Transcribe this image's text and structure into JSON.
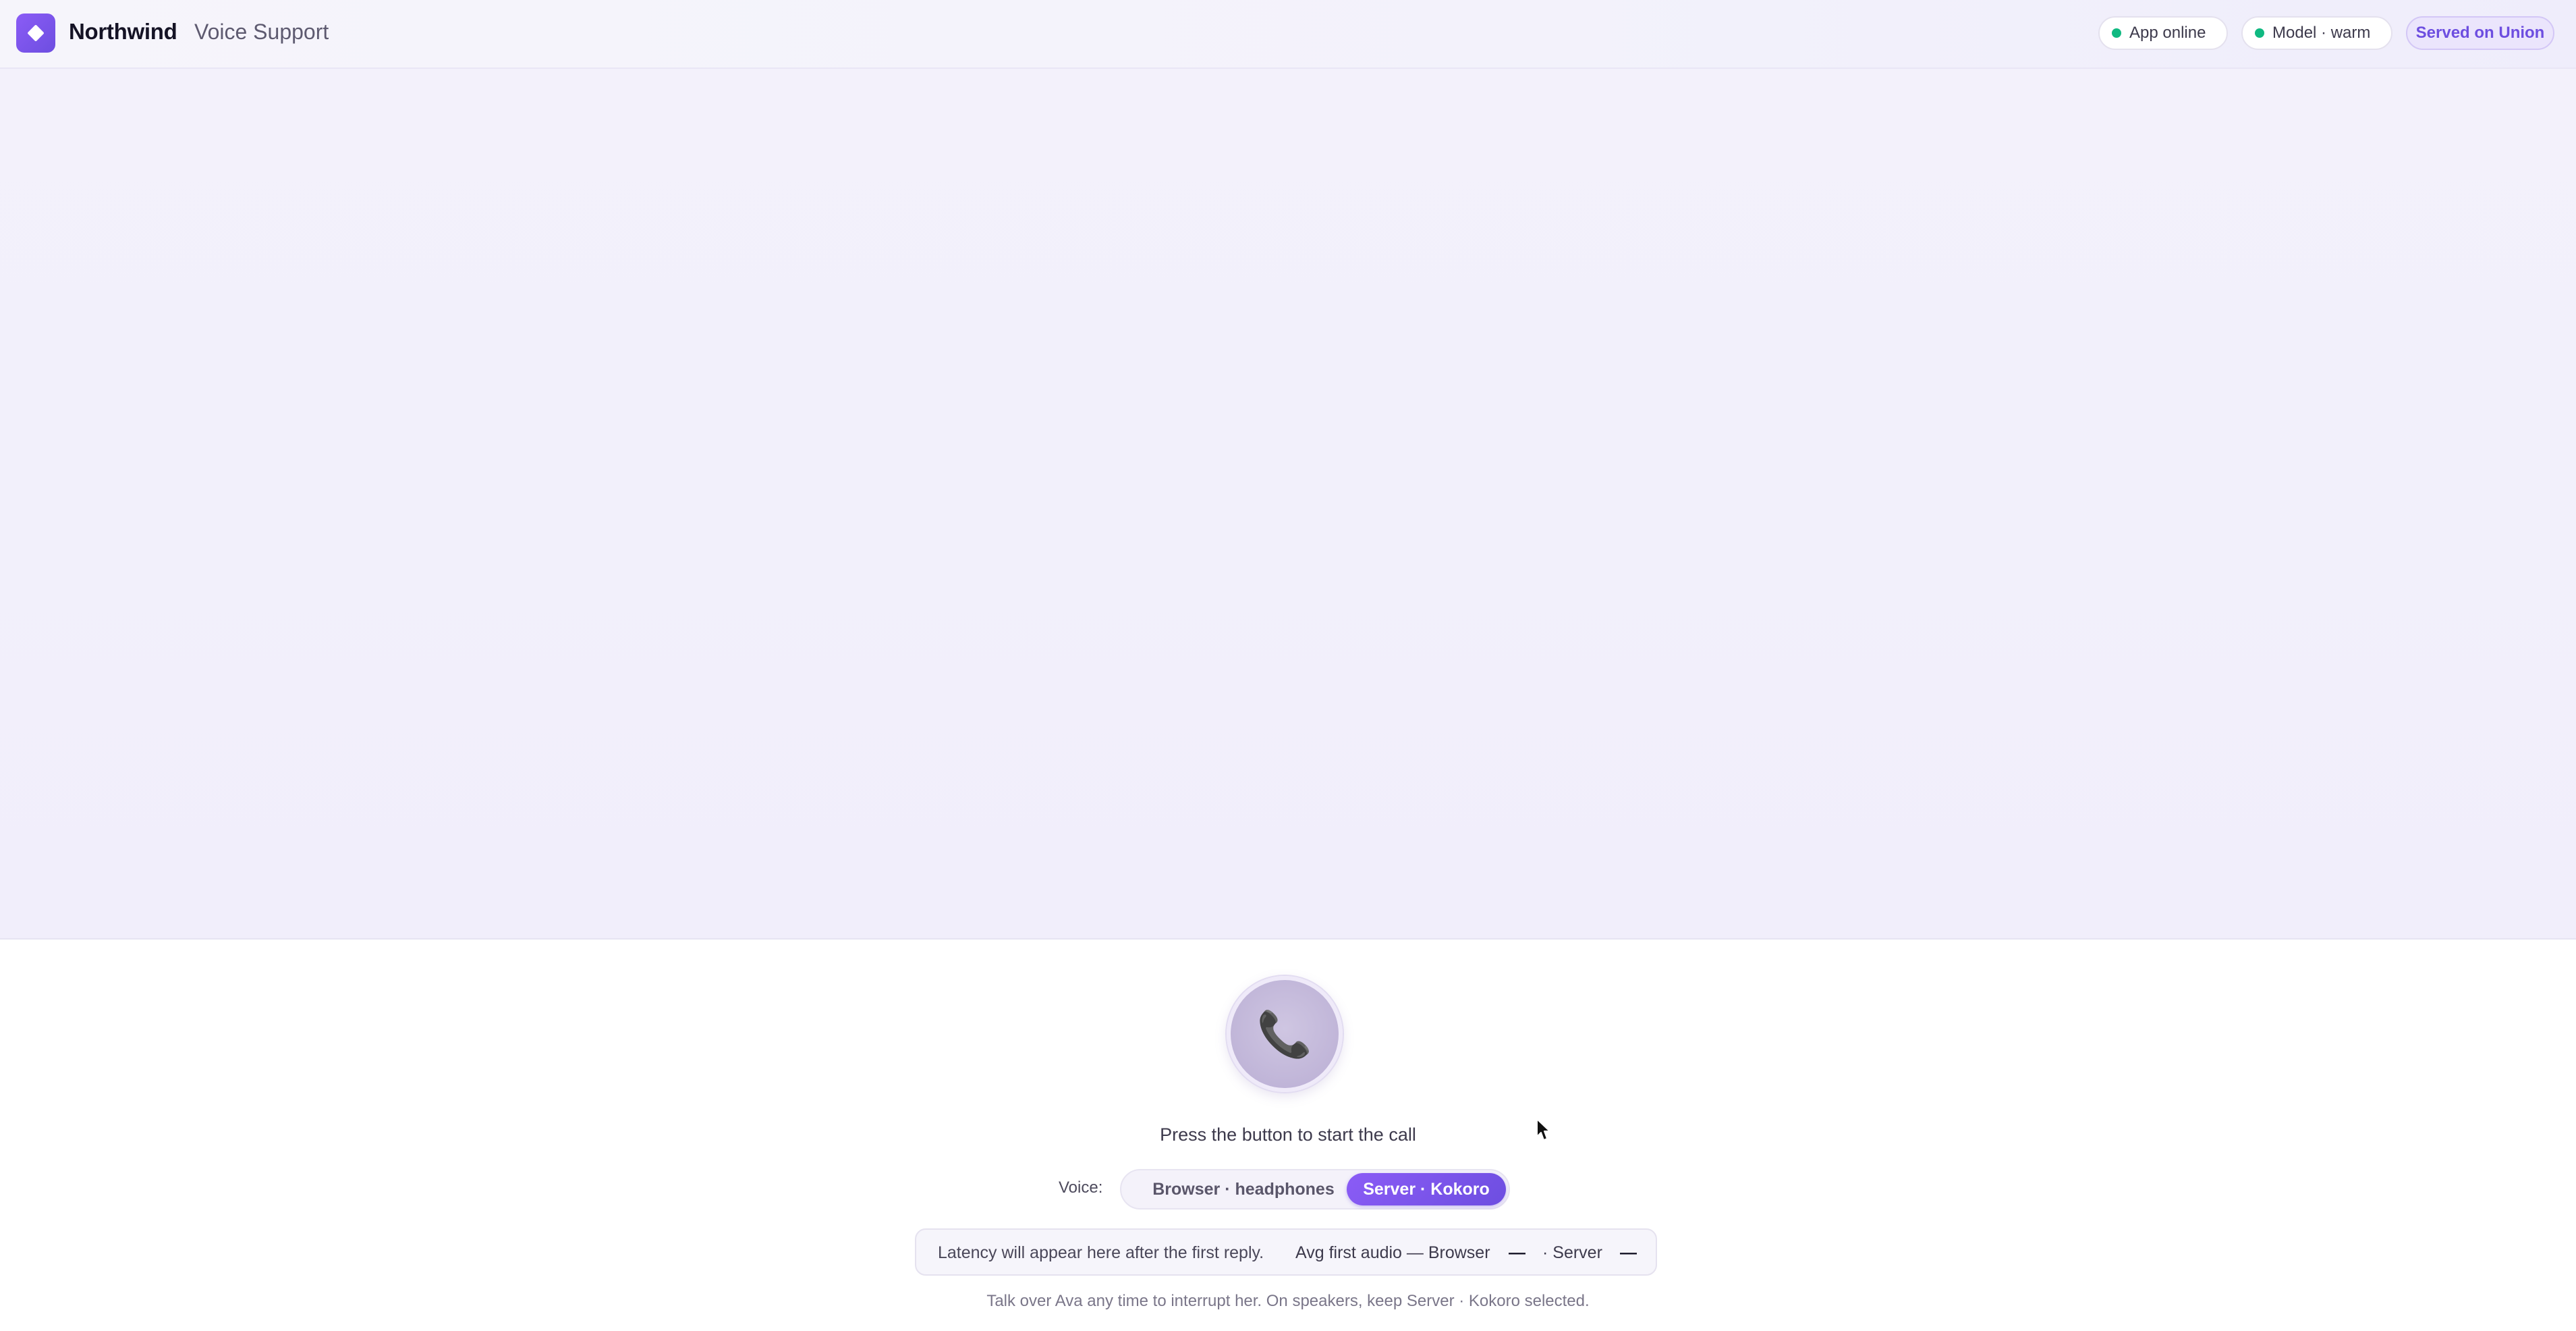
{
  "header": {
    "brand_name": "Northwind",
    "brand_subtitle": "Voice Support",
    "status_app": "App online",
    "status_model": "Model · warm",
    "served_on": "Served on Union",
    "status_dot_color": "#10b981",
    "accent_color": "#6d4ee0"
  },
  "call": {
    "button_icon": "phone-icon",
    "prompt": "Press the button to start the call"
  },
  "voice": {
    "label": "Voice:",
    "options": [
      "Browser · headphones",
      "Server · Kokoro"
    ],
    "selected": "Server · Kokoro"
  },
  "latency": {
    "message": "Latency will appear here after the first reply.",
    "avg_label": "Avg first audio — Browser",
    "browser_value": "—",
    "server_label": "· Server",
    "server_value": "—"
  },
  "hint": "Talk over Ava any time to interrupt her. On speakers, keep Server · Kokoro selected."
}
